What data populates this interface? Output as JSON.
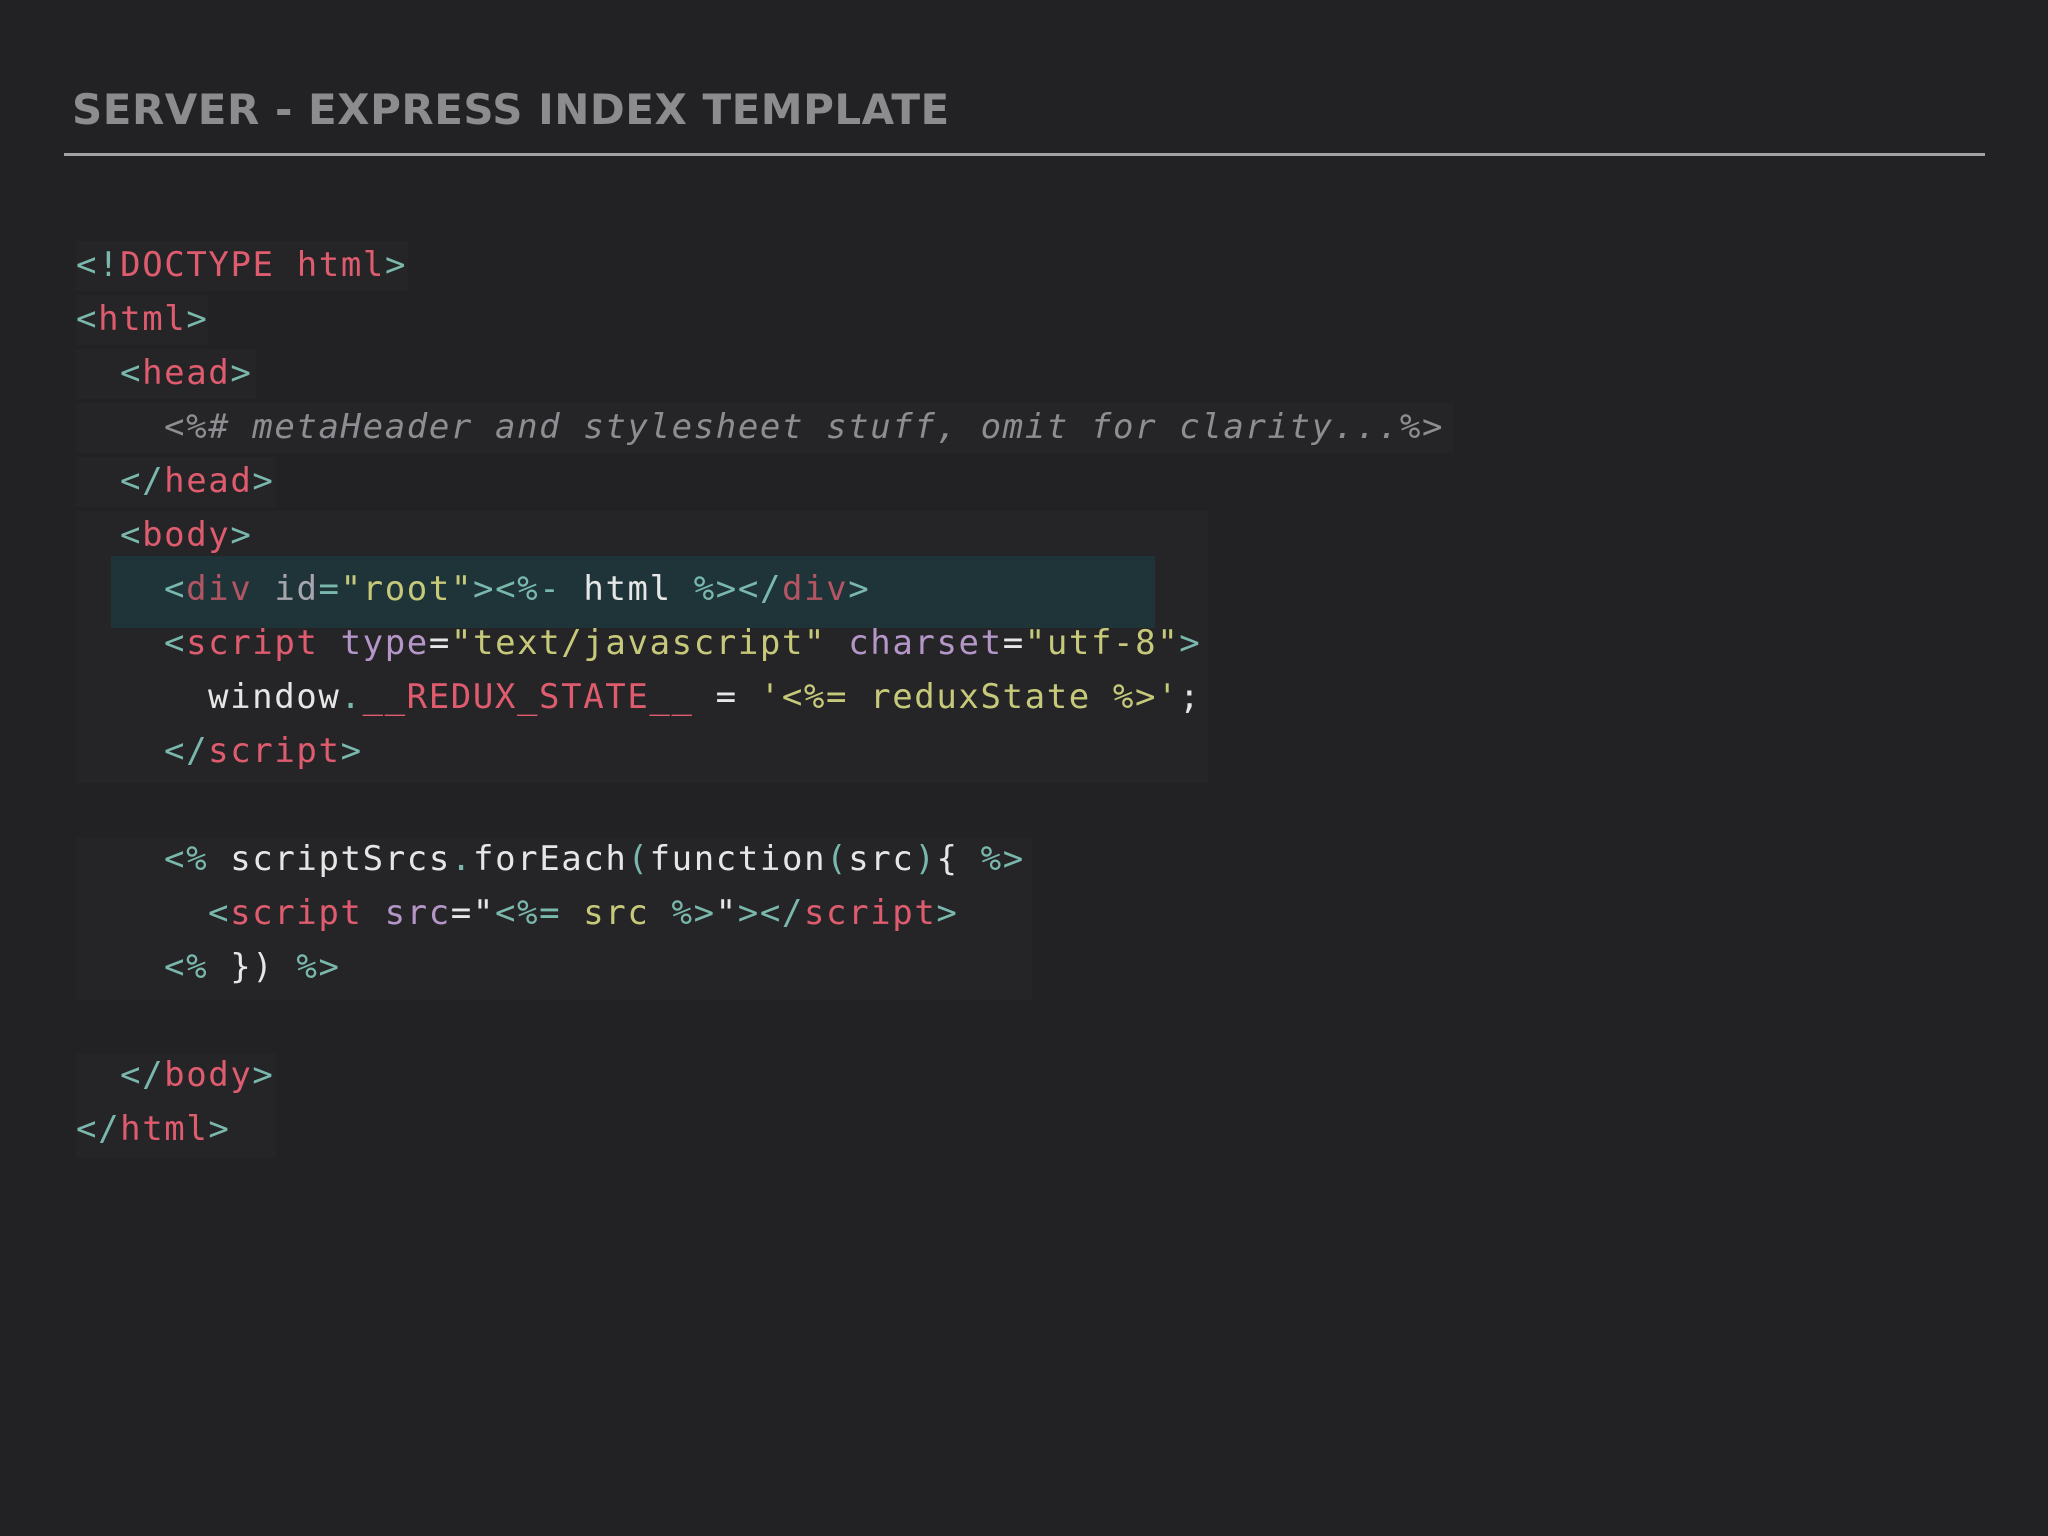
{
  "slide": {
    "title": "SERVER - EXPRESS INDEX TEMPLATE"
  },
  "code": {
    "l1": {
      "lt": "<!",
      "tag": "DOCTYPE html",
      "gt": ">"
    },
    "l2": {
      "lt": "<",
      "tag": "html",
      "gt": ">"
    },
    "l3": {
      "lt": "<",
      "tag": "head",
      "gt": ">"
    },
    "l4": {
      "comment": "<%# metaHeader and stylesheet stuff, omit for clarity...%>"
    },
    "l5": {
      "lt": "</",
      "tag": "head",
      "gt": ">"
    },
    "l6": {
      "lt": "<",
      "tag": "body",
      "gt": ">"
    },
    "l7": {
      "lt": "<",
      "tag": "div",
      "sp": " ",
      "attr": "id",
      "eq": "=",
      "val": "\"root\"",
      "gt": ">",
      "ejs_open": "<%-",
      "expr": " html ",
      "ejs_close": "%>",
      "close_lt": "</",
      "close_tag": "div",
      "close_gt": ">"
    },
    "l8": {
      "lt": "<",
      "tag": "script",
      "sp1": " ",
      "attr1": "type",
      "eq1": "=",
      "val1": "\"text/javascript\"",
      "sp2": " ",
      "attr2": "charset",
      "eq2": "=",
      "val2": "\"utf-8\"",
      "gt": ">"
    },
    "l9": {
      "obj": "window",
      "dot": ".",
      "prop": "__REDUX_STATE__",
      "assign": " = ",
      "q1": "'",
      "ejs_open": "<%=",
      "expr": " reduxState ",
      "ejs_close": "%>",
      "q2": "'",
      "semi": ";"
    },
    "l10": {
      "lt": "</",
      "tag": "script",
      "gt": ">"
    },
    "l11": {
      "ejs_open": "<%",
      "a": " scriptSrcs",
      "dot": ".",
      "b": "forEach",
      "po": "(",
      "c": "function",
      "pi": "(",
      "d": "src",
      "pc": ")",
      "brace": "{",
      "e": " ",
      "ejs_close": "%>"
    },
    "l12": {
      "lt": "<",
      "tag": "script",
      "sp": " ",
      "attr": "src",
      "eq": "=",
      "q1": "\"",
      "ejs_open": "<%=",
      "expr": " src ",
      "ejs_close": "%>",
      "q2": "\"",
      "gt": ">",
      "close_lt": "</",
      "close_tag": "script",
      "close_gt": ">"
    },
    "l13": {
      "ejs_open": "<%",
      "body": " }) ",
      "ejs_close": "%>"
    },
    "l14": {
      "lt": "</",
      "tag": "body",
      "gt": ">"
    },
    "l15": {
      "lt": "</",
      "tag": "html",
      "gt": ">"
    }
  },
  "colors": {
    "background": "#222224",
    "title": "#8c8c8e",
    "punctuation": "#7ab8ad",
    "tag": "#df5c6f",
    "attribute": "#b596c8",
    "string": "#c7c97a",
    "comment": "#8d8d92",
    "highlight": "#1f3438"
  }
}
